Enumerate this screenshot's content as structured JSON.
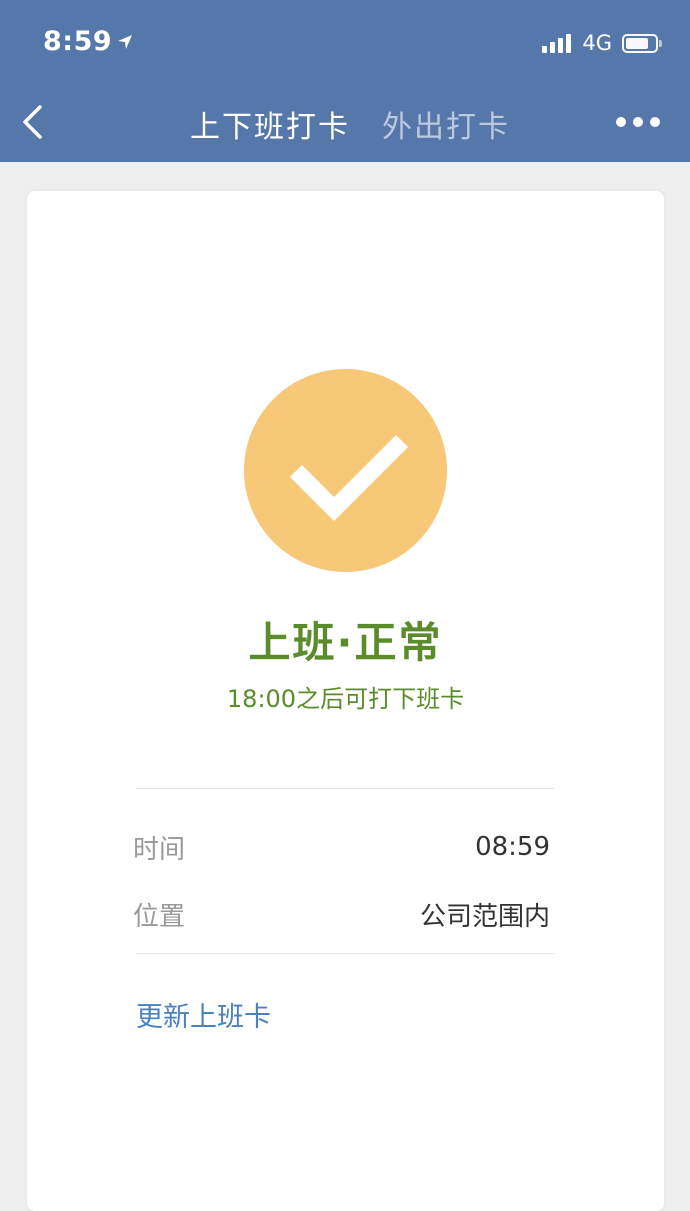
{
  "status_bar": {
    "time": "8:59",
    "network": "4G"
  },
  "nav": {
    "tabs": [
      {
        "label": "上下班打卡",
        "active": true
      },
      {
        "label": "外出打卡",
        "active": false
      }
    ]
  },
  "result": {
    "title": "上班·正常",
    "subtitle": "18:00之后可打下班卡"
  },
  "details": [
    {
      "label": "时间",
      "value": "08:59"
    },
    {
      "label": "位置",
      "value": "公司范围内"
    }
  ],
  "actions": {
    "update_label": "更新上班卡"
  },
  "colors": {
    "header": "#5577aa",
    "check_circle": "#f7c878",
    "success_text": "#5a8c2a",
    "link": "#4a7fc0"
  }
}
